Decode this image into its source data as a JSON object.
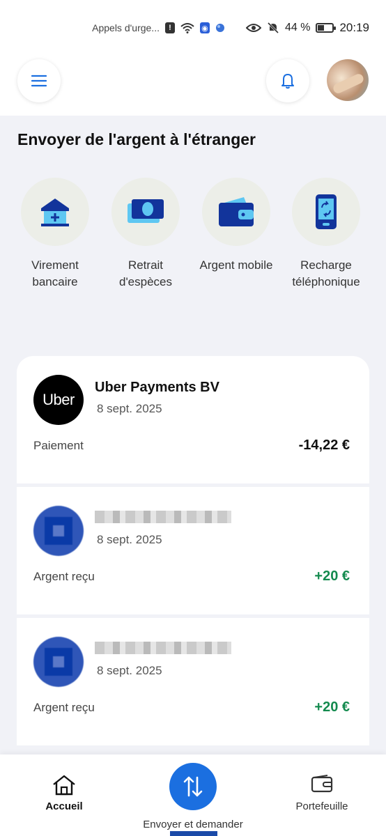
{
  "status_bar": {
    "carrier_text": "Appels d'urge...",
    "battery_percent": "44 %",
    "time": "20:19"
  },
  "header": {
    "menu_icon": "hamburger-icon",
    "bell_icon": "bell-icon"
  },
  "send_section": {
    "title": "Envoyer de l'argent à l'étranger",
    "actions": [
      {
        "label": "Virement bancaire",
        "icon": "bank-icon"
      },
      {
        "label": "Retrait d'espèces",
        "icon": "cash-icon"
      },
      {
        "label": "Argent mobile",
        "icon": "wallet-icon"
      },
      {
        "label": "Recharge téléphonique",
        "icon": "phone-recharge-icon"
      }
    ]
  },
  "transactions": [
    {
      "name": "Uber Payments BV",
      "logo_text": "Uber",
      "date": "8 sept. 2025",
      "type": "Paiement",
      "amount": "-14,22 €"
    },
    {
      "name": "",
      "date": "8 sept. 2025",
      "type": "Argent reçu",
      "amount": "+20 €"
    },
    {
      "name": "",
      "date": "8 sept. 2025",
      "type": "Argent reçu",
      "amount": "+20 €"
    }
  ],
  "bottom_nav": {
    "home": "Accueil",
    "send": "Envoyer et demander",
    "wallet": "Portefeuille"
  },
  "colors": {
    "accent": "#1b6fe0",
    "positive": "#138a4e",
    "background": "#f1f2f7"
  }
}
